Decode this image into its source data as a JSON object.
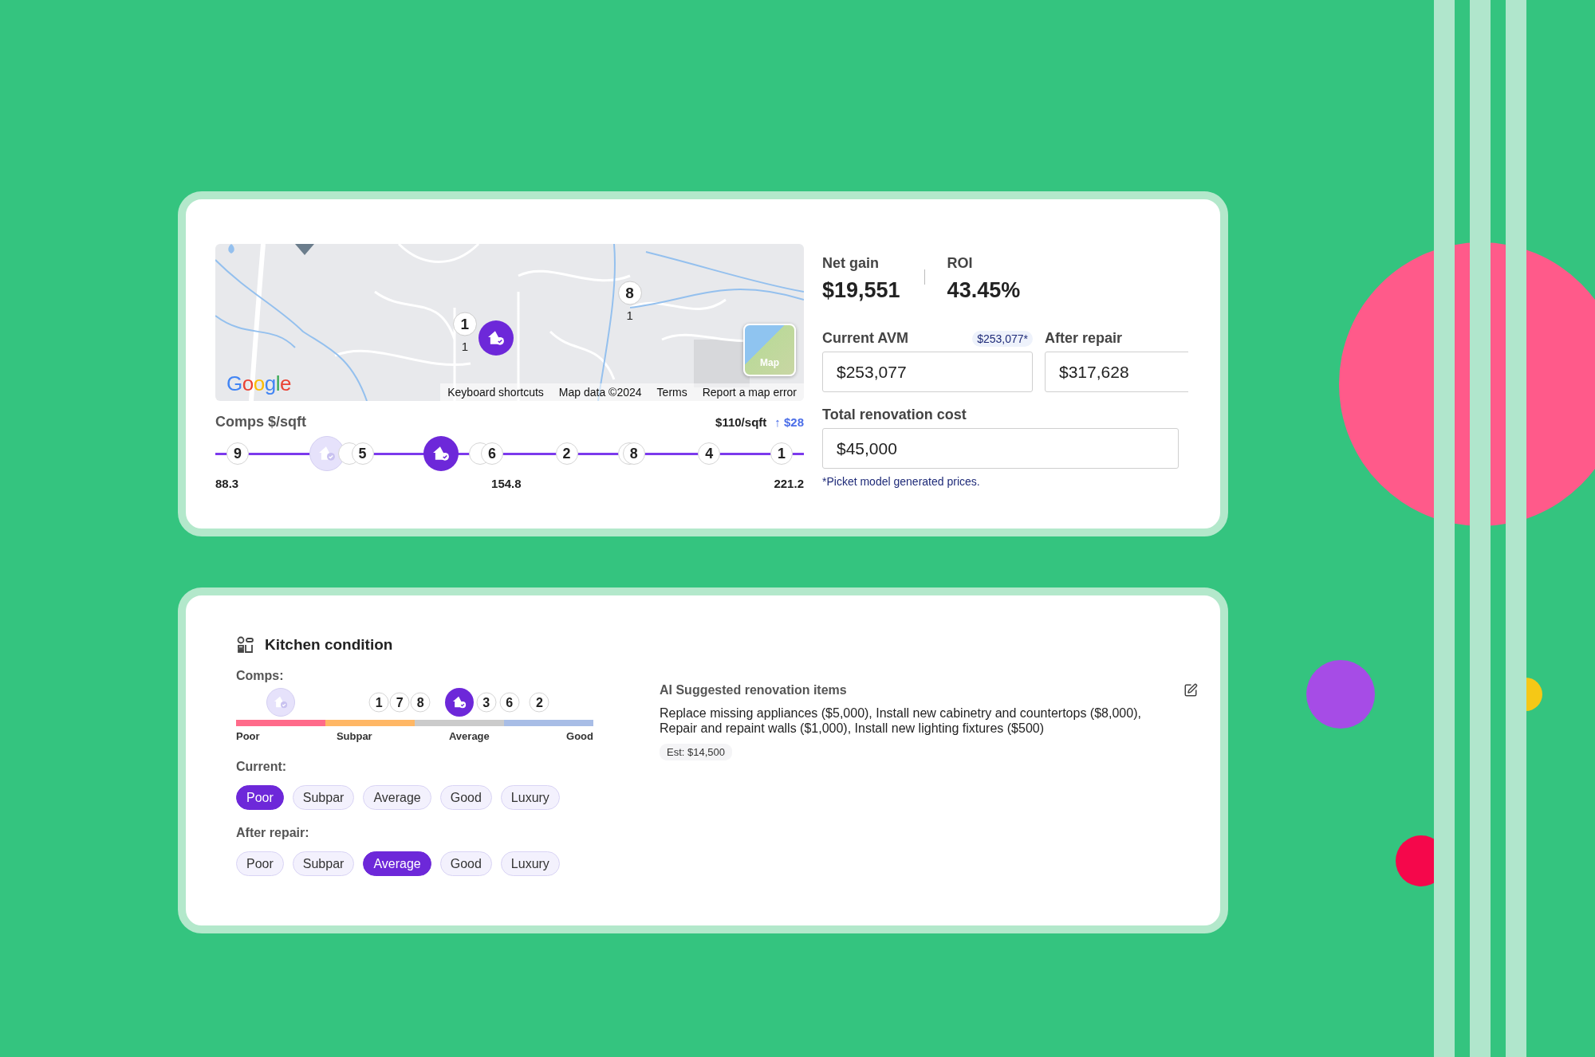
{
  "deal_card": {
    "map": {
      "kind": "picture",
      "logo": "Google",
      "markers": [
        {
          "kind": "comp",
          "label": "1",
          "sublabel": "1"
        },
        {
          "kind": "home"
        },
        {
          "kind": "comp",
          "label": "8",
          "sublabel": "1"
        }
      ],
      "map_type_button": "Map",
      "footer_links": [
        "Keyboard shortcuts",
        "Map data ©2024",
        "Terms",
        "Report a map error"
      ]
    },
    "comps": {
      "title": "Comps $/sqft",
      "price": "$110/sqft",
      "change": "↑ $28",
      "axis_labels": [
        "88.3",
        "154.8",
        "221.2"
      ],
      "markers": [
        {
          "kind": "comp",
          "label": "9"
        },
        {
          "kind": "home",
          "faded": true
        },
        {
          "kind": "comp"
        },
        {
          "kind": "comp",
          "label": "5"
        },
        {
          "kind": "home",
          "faded": false
        },
        {
          "kind": "comp"
        },
        {
          "kind": "comp",
          "label": "6"
        },
        {
          "kind": "comp",
          "label": "2"
        },
        {
          "kind": "comp"
        },
        {
          "kind": "comp",
          "label": "8"
        },
        {
          "kind": "comp",
          "label": "4"
        },
        {
          "kind": "comp",
          "label": "1"
        }
      ]
    },
    "net_gain": {
      "label": "Net gain",
      "value": "$19,551"
    },
    "roi": {
      "label": "ROI",
      "value": "43.45%"
    },
    "fields": [
      {
        "label": "Current AVM",
        "badge": "$253,077*",
        "value": "$253,077"
      },
      {
        "label": "After repair",
        "value": "$317,628"
      }
    ],
    "renovation": {
      "label": "Total renovation cost",
      "value": "$45,000"
    },
    "note": "*Picket model generated prices."
  },
  "kitchen_card": {
    "title": "Kitchen condition",
    "comps_label": "Comps:",
    "scale_labels": [
      "Poor",
      "Subpar",
      "Average",
      "Good"
    ],
    "markers": [
      {
        "kind": "home",
        "faded": true
      },
      {
        "kind": "comp",
        "label": "1"
      },
      {
        "kind": "comp",
        "label": "7"
      },
      {
        "kind": "comp",
        "label": "8"
      },
      {
        "kind": "home",
        "faded": false
      },
      {
        "kind": "comp",
        "label": "3"
      },
      {
        "kind": "comp",
        "label": "6"
      },
      {
        "kind": "comp",
        "label": "2"
      }
    ],
    "current": {
      "label": "Current:",
      "options": [
        {
          "label": "Poor",
          "selected": true
        },
        {
          "label": "Subpar",
          "selected": false
        },
        {
          "label": "Average",
          "selected": false
        },
        {
          "label": "Good",
          "selected": false
        },
        {
          "label": "Luxury",
          "selected": false
        }
      ]
    },
    "after_repair": {
      "label": "After repair:",
      "options": [
        {
          "label": "Poor",
          "selected": false
        },
        {
          "label": "Subpar",
          "selected": false
        },
        {
          "label": "Average",
          "selected": true
        },
        {
          "label": "Good",
          "selected": false
        },
        {
          "label": "Luxury",
          "selected": false
        }
      ]
    },
    "ai": {
      "title": "AI Suggested renovation items",
      "text": "Replace missing appliances ($5,000), Install new cabinetry and countertops ($8,000), Repair and repaint walls ($1,000), Install new lighting fixtures ($500)",
      "estimate": "Est: $14,500"
    }
  }
}
